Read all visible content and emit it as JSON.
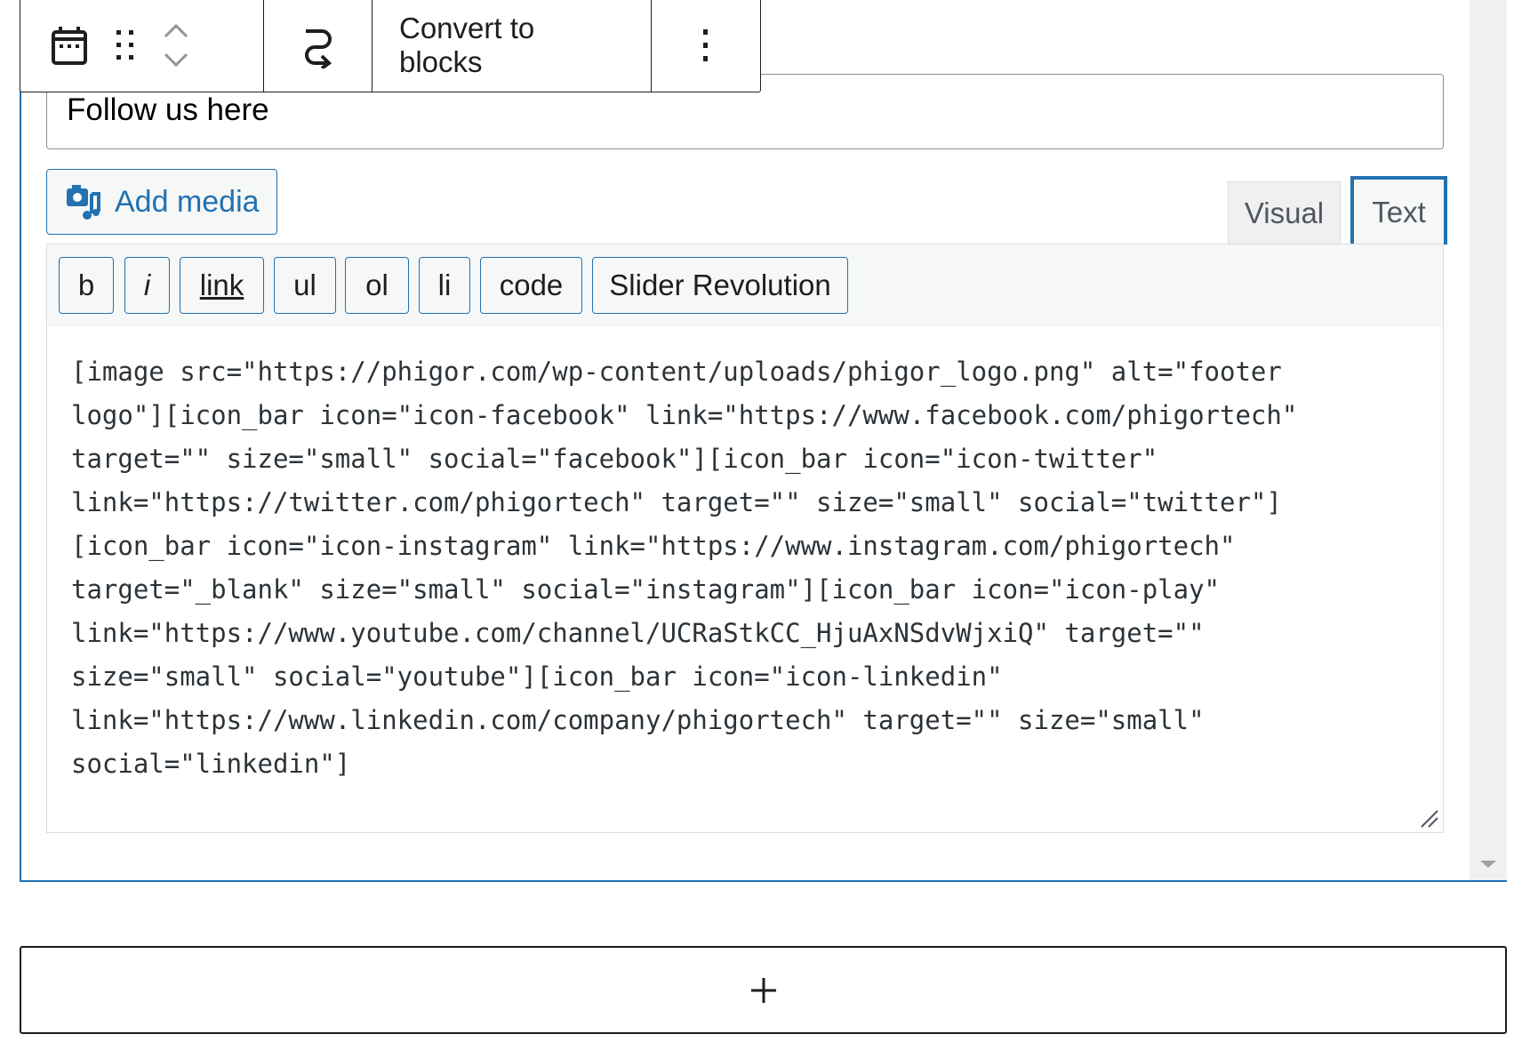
{
  "toolbar": {
    "block_icon": "calendar-icon",
    "drag_icon": "drag-handle-icon",
    "move_icons": [
      "chevron-up-icon",
      "chevron-down-icon"
    ],
    "transform_icon": "transform-arrow-icon",
    "convert_label": "Convert to blocks",
    "options_icon": "more-vertical-icon"
  },
  "widget": {
    "title_value": "Follow us here",
    "add_media_label": "Add media",
    "tabs": [
      {
        "label": "Visual",
        "active": false
      },
      {
        "label": "Text",
        "active": true
      }
    ],
    "quicktags": [
      "b",
      "i",
      "link",
      "ul",
      "ol",
      "li",
      "code",
      "Slider Revolution"
    ],
    "content_lines": [
      "[image src=\"https://phigor.com/wp-content/uploads/phigor_logo.png\" alt=\"footer",
      "logo\"][icon_bar icon=\"icon-facebook\" link=\"https://www.facebook.com/phigortech\"",
      "target=\"\" size=\"small\" social=\"facebook\"][icon_bar icon=\"icon-twitter\"",
      "link=\"https://twitter.com/phigortech\" target=\"\" size=\"small\" social=\"twitter\"]",
      "[icon_bar icon=\"icon-instagram\" link=\"https://www.instagram.com/phigortech\"",
      "target=\"_blank\" size=\"small\" social=\"instagram\"][icon_bar icon=\"icon-play\"",
      "link=\"https://www.youtube.com/channel/UCRaStkCC_HjuAxNSdvWjxiQ\" target=\"\"",
      "size=\"small\" social=\"youtube\"][icon_bar icon=\"icon-linkedin\"",
      "link=\"https://www.linkedin.com/company/phigortech\" target=\"\" size=\"small\"",
      "social=\"linkedin\"]"
    ]
  },
  "add_block": {
    "icon": "plus-icon"
  },
  "colors": {
    "accent": "#2271b1",
    "border": "#1e1e1e",
    "toolbar_bg": "#f6f7f7"
  }
}
